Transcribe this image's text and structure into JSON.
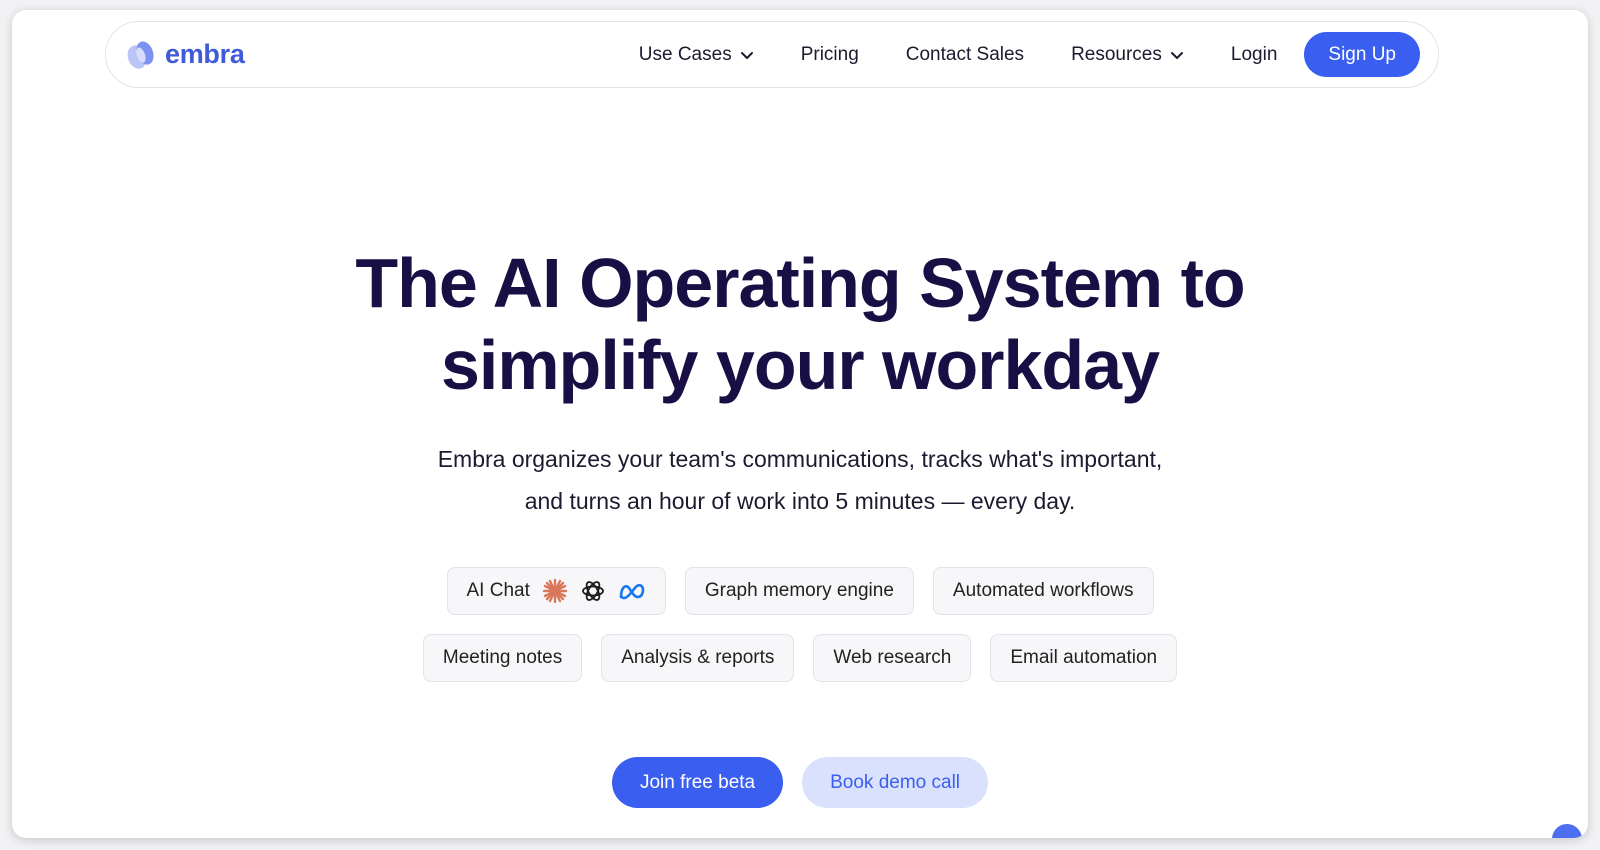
{
  "nav": {
    "brand": "embra",
    "links": [
      {
        "label": "Use Cases",
        "dropdown": true
      },
      {
        "label": "Pricing",
        "dropdown": false
      },
      {
        "label": "Contact Sales",
        "dropdown": false
      },
      {
        "label": "Resources",
        "dropdown": true
      },
      {
        "label": "Login",
        "dropdown": false
      }
    ],
    "signup": "Sign Up"
  },
  "hero": {
    "title_line1": "The AI Operating System to",
    "title_line2": "simplify your workday",
    "subtitle_line1": "Embra organizes your team's communications, tracks what's important,",
    "subtitle_line2": "and turns an hour of work into 5 minutes — every day."
  },
  "features": {
    "row1": [
      "AI Chat",
      "Graph memory engine",
      "Automated workflows"
    ],
    "row2": [
      "Meeting notes",
      "Analysis & reports",
      "Web research",
      "Email automation"
    ],
    "ai_chat_icons": [
      "anthropic-icon",
      "openai-icon",
      "meta-icon"
    ]
  },
  "cta": {
    "primary": "Join free beta",
    "secondary": "Book demo call"
  },
  "colors": {
    "accent": "#3a5ef0",
    "accent_light": "#d9e1fc",
    "title": "#1a0f45",
    "brand": "#3f5bd9"
  }
}
